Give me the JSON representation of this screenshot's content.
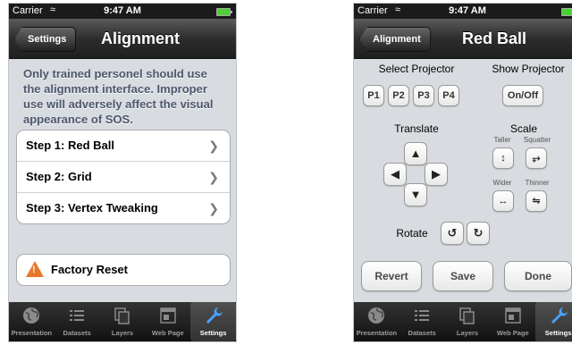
{
  "status": {
    "carrier": "Carrier",
    "time": "9:47 AM"
  },
  "left": {
    "back_label": "Settings",
    "title": "Alignment",
    "warning": "Only trained personel should use the alignment interface. Improper use will adversely affect the visual appearance of SOS.",
    "steps": [
      {
        "label": "Step 1:  Red Ball"
      },
      {
        "label": "Step 2:  Grid"
      },
      {
        "label": "Step 3:  Vertex Tweaking"
      }
    ],
    "factory_reset": "Factory Reset"
  },
  "right": {
    "back_label": "Alignment",
    "title": "Red Ball",
    "select_projector": "Select Projector",
    "show_projector": "Show Projector",
    "projectors": [
      "P1",
      "P2",
      "P3",
      "P4"
    ],
    "onoff": "On/Off",
    "translate": "Translate",
    "scale": "Scale",
    "taller": "Taller",
    "squatter": "Squatter",
    "wider": "Wider",
    "thinner": "Thinner",
    "rotate": "Rotate",
    "revert": "Revert",
    "save": "Save",
    "done": "Done"
  },
  "tabs": [
    {
      "label": "Presentation",
      "icon": "globe-icon"
    },
    {
      "label": "Datasets",
      "icon": "list-icon"
    },
    {
      "label": "Layers",
      "icon": "layers-icon"
    },
    {
      "label": "Web Page",
      "icon": "webpage-icon"
    },
    {
      "label": "Settings",
      "icon": "wrench-icon",
      "active": true
    }
  ]
}
